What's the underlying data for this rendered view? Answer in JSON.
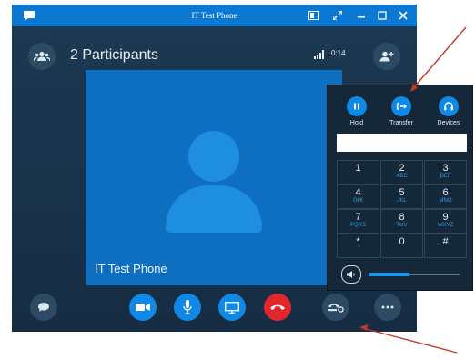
{
  "window": {
    "title": "IT Test Phone"
  },
  "header": {
    "participants_label": "2 Participants",
    "call_time": "0:14"
  },
  "tile": {
    "name": "IT Test Phone"
  },
  "dialpad": {
    "actions": [
      {
        "label": "Hold",
        "icon": "pause-icon"
      },
      {
        "label": "Transfer",
        "icon": "transfer-icon"
      },
      {
        "label": "Devices",
        "icon": "headset-icon"
      }
    ],
    "input_value": "",
    "keys": [
      {
        "digit": "1",
        "letters": ""
      },
      {
        "digit": "2",
        "letters": "ABC"
      },
      {
        "digit": "3",
        "letters": "DEF"
      },
      {
        "digit": "4",
        "letters": "GHI"
      },
      {
        "digit": "5",
        "letters": "JKL"
      },
      {
        "digit": "6",
        "letters": "MNO"
      },
      {
        "digit": "7",
        "letters": "PQRS"
      },
      {
        "digit": "8",
        "letters": "TUV"
      },
      {
        "digit": "9",
        "letters": "WXYZ"
      },
      {
        "digit": "*",
        "letters": ""
      },
      {
        "digit": "0",
        "letters": ""
      },
      {
        "digit": "#",
        "letters": ""
      }
    ],
    "volume_level": 0.45
  },
  "colors": {
    "accent": "#0e89e6",
    "titlebar": "#0b78d1",
    "hangup": "#e0272e",
    "annotation_arrow": "#c0392b"
  }
}
